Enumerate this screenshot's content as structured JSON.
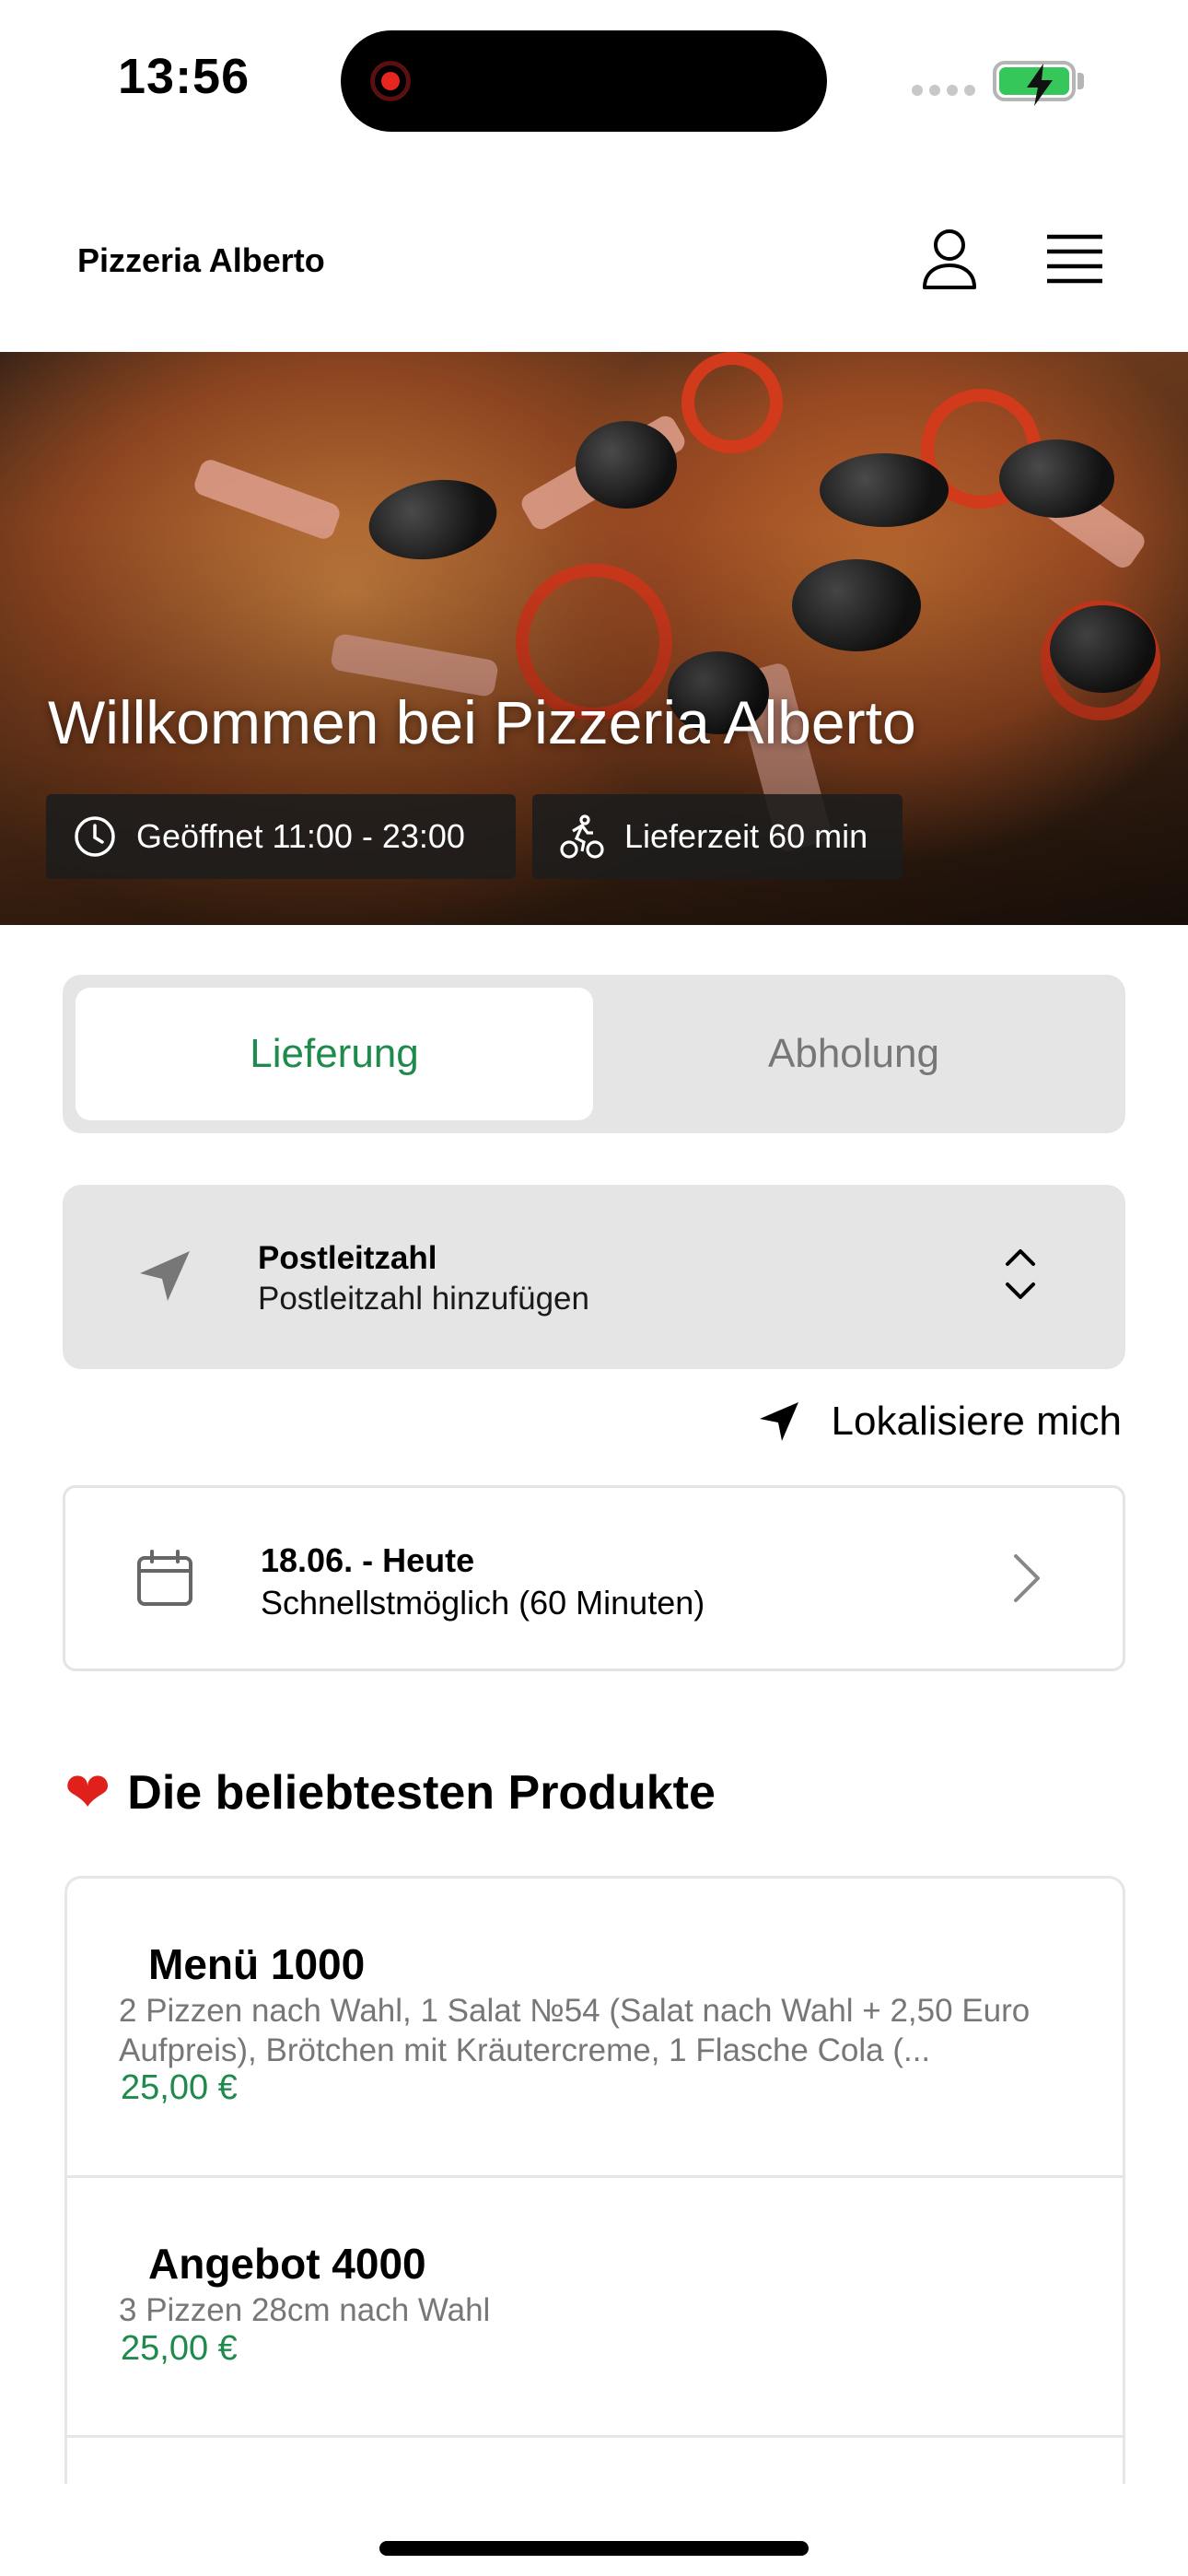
{
  "status_bar": {
    "time": "13:56"
  },
  "header": {
    "brand": "Pizzeria Alberto",
    "icons": {
      "account": "user-icon",
      "menu": "hamburger-menu-icon"
    }
  },
  "hero": {
    "title": "Willkommen bei Pizzeria Alberto",
    "opening_hours": "Geöffnet 11:00 - 23:00",
    "delivery_time": "Lieferzeit 60 min"
  },
  "order_mode": {
    "options": [
      "Lieferung",
      "Abholung"
    ],
    "selected": "Lieferung"
  },
  "postcode": {
    "title": "Postleitzahl",
    "placeholder": "Postleitzahl hinzufügen"
  },
  "locate_label": "Lokalisiere mich",
  "delivery_date": {
    "title": "18.06. - Heute",
    "subtitle": "Schnellstmöglich (60 Minuten)"
  },
  "popular": {
    "heading": "Die beliebtesten Produkte",
    "products": [
      {
        "name": "Menü 1000",
        "description": "2 Pizzen nach Wahl, 1 Salat №54 (Salat nach Wahl + 2,50 Euro Aufpreis), Brötchen mit Kräutercreme, 1 Flasche Cola (...",
        "price": "25,00 €"
      },
      {
        "name": "Angebot 4000",
        "description": "3 Pizzen 28cm nach Wahl",
        "price": "25,00 €"
      }
    ]
  },
  "colors": {
    "accent_green": "#1e8a4c",
    "panel_grey": "#e5e5e5",
    "chip_dark": "#1c1c1c"
  }
}
